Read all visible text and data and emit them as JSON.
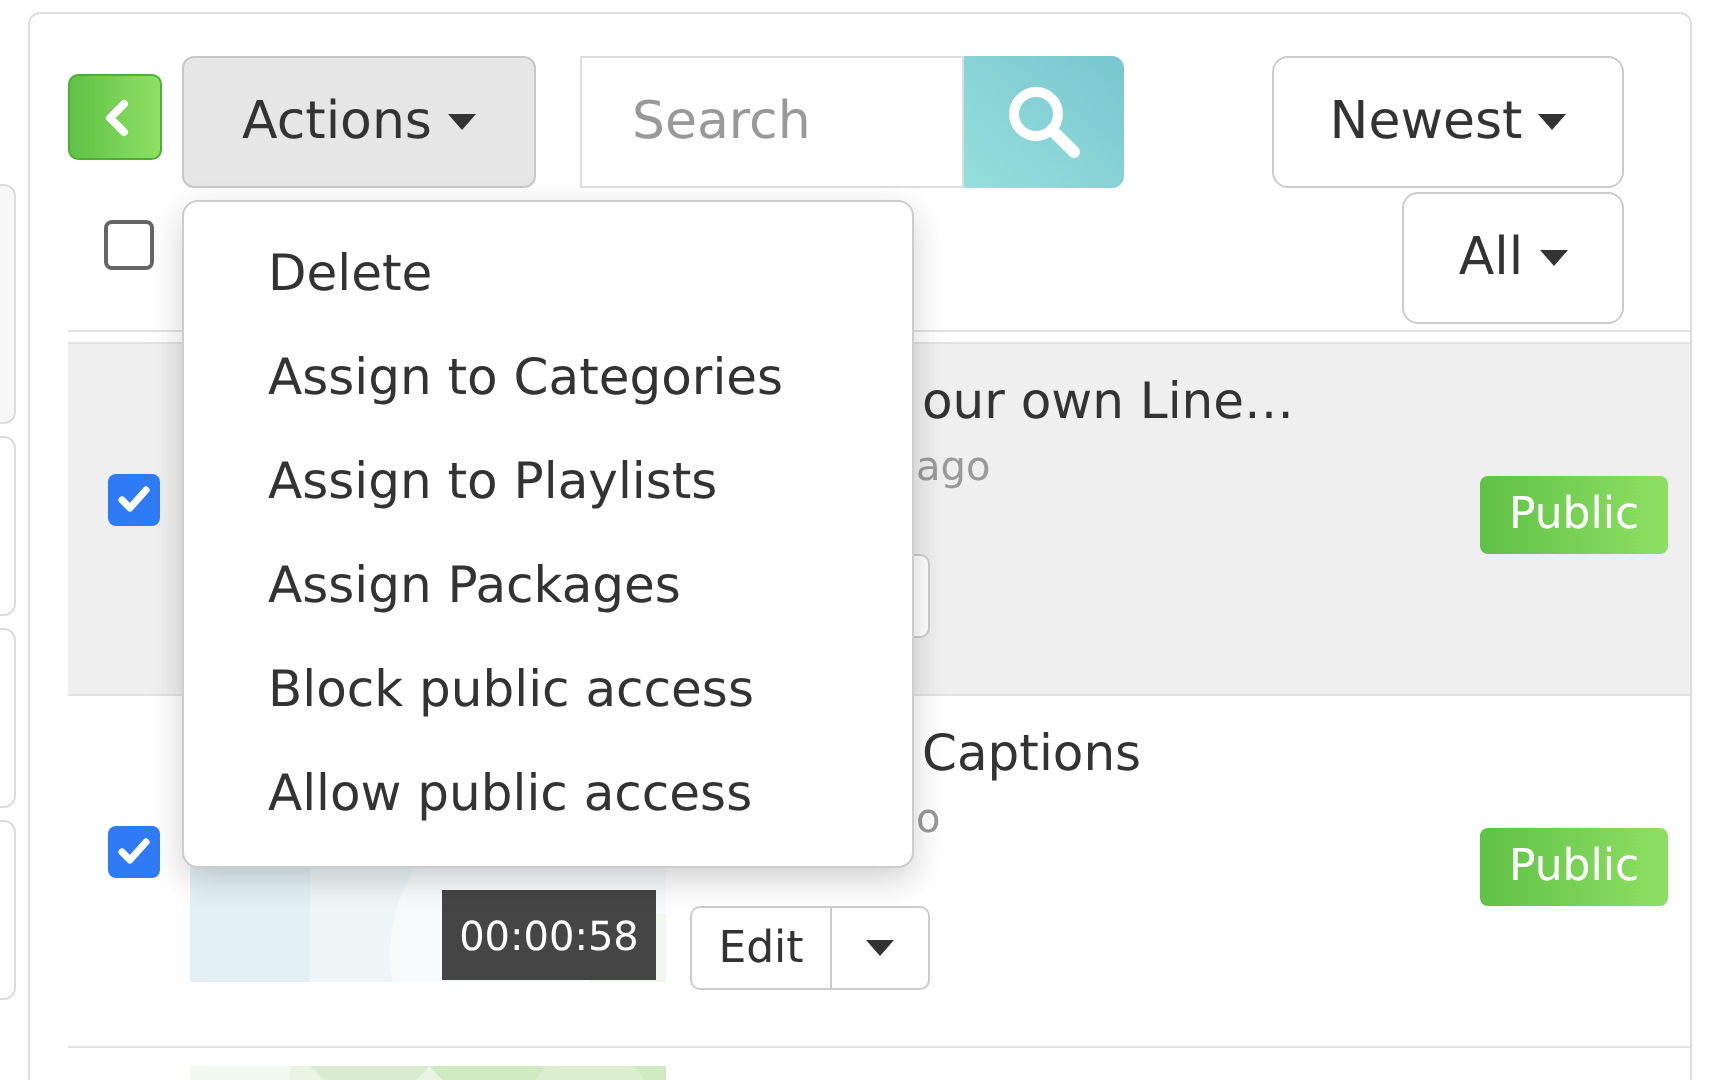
{
  "toolbar": {
    "actions_label": "Actions",
    "search": {
      "placeholder": "Search"
    },
    "sort_label": "Newest",
    "filter_label": "All",
    "select_all": {
      "checked": false
    }
  },
  "actions_menu": {
    "expanded": true,
    "items": [
      "Delete",
      "Assign to Categories",
      "Assign to Playlists",
      "Assign Packages",
      "Block public access",
      "Allow public access"
    ]
  },
  "rows": [
    {
      "checked": true,
      "highlighted": true,
      "title": "our own Line…",
      "meta": "ago",
      "status": "Public",
      "edit_button": true
    },
    {
      "checked": true,
      "highlighted": false,
      "duration": "00:00:58",
      "title": "Captions",
      "meta": "o",
      "status": "Public",
      "edit_button": true,
      "edit_label": "Edit"
    },
    {
      "highlighted": false
    }
  ]
}
